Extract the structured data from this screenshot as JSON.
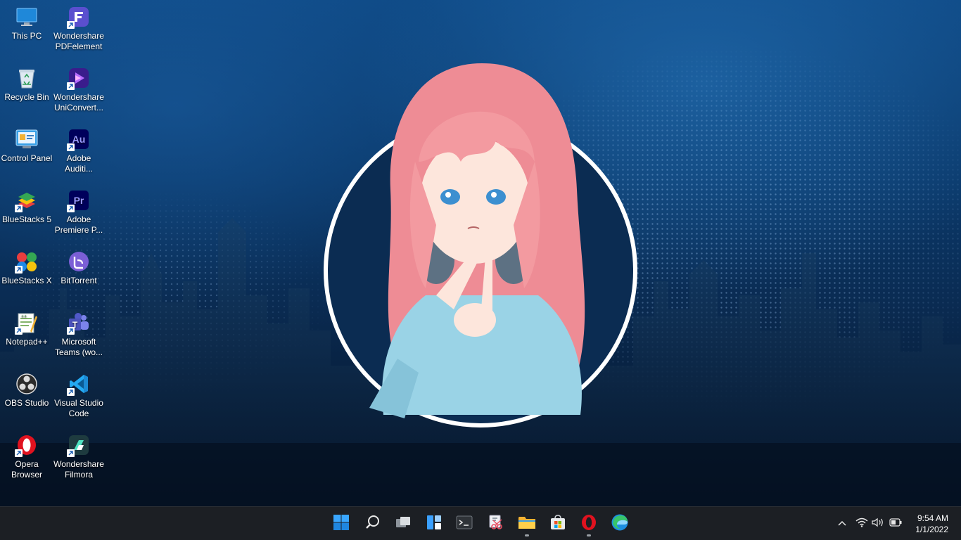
{
  "desktop": {
    "icons": [
      {
        "label": "This PC",
        "icon": "computer-icon"
      },
      {
        "label": "Wondershare PDFelement",
        "icon": "pdfelement-icon"
      },
      {
        "label": "Recycle Bin",
        "icon": "recycle-bin-icon"
      },
      {
        "label": "Wondershare UniConvert...",
        "icon": "uniconverter-icon"
      },
      {
        "label": "Control Panel",
        "icon": "control-panel-icon"
      },
      {
        "label": "Adobe Auditi...",
        "icon": "adobe-audition-icon"
      },
      {
        "label": "BlueStacks 5",
        "icon": "bluestacks-icon"
      },
      {
        "label": "Adobe Premiere P...",
        "icon": "adobe-premiere-icon"
      },
      {
        "label": "BlueStacks X",
        "icon": "bluestacks-x-icon"
      },
      {
        "label": "BitTorrent",
        "icon": "bittorrent-icon"
      },
      {
        "label": "Notepad++",
        "icon": "notepad-plus-plus-icon"
      },
      {
        "label": "Microsoft Teams (wo...",
        "icon": "teams-icon"
      },
      {
        "label": "OBS Studio",
        "icon": "obs-icon"
      },
      {
        "label": "Visual Studio Code",
        "icon": "vscode-icon"
      },
      {
        "label": "Opera Browser",
        "icon": "opera-icon"
      },
      {
        "label": "Wondershare Filmora",
        "icon": "filmora-icon"
      }
    ]
  },
  "taskbar": {
    "apps": [
      {
        "name": "start",
        "icon": "windows-start-icon",
        "running": false
      },
      {
        "name": "search",
        "icon": "search-icon",
        "running": false
      },
      {
        "name": "task-view",
        "icon": "task-view-icon",
        "running": false
      },
      {
        "name": "widgets",
        "icon": "widgets-icon",
        "running": false
      },
      {
        "name": "terminal",
        "icon": "terminal-icon",
        "running": false
      },
      {
        "name": "snipping-tool",
        "icon": "snipping-tool-icon",
        "running": false
      },
      {
        "name": "file-explorer",
        "icon": "folder-icon",
        "running": true
      },
      {
        "name": "microsoft-store",
        "icon": "store-icon",
        "running": false
      },
      {
        "name": "opera",
        "icon": "opera-icon",
        "running": true
      },
      {
        "name": "edge",
        "icon": "edge-icon",
        "running": false
      }
    ],
    "tray": {
      "icons": [
        "chevron-up-icon",
        "wifi-icon",
        "volume-icon",
        "battery-icon"
      ],
      "time": "9:54 AM",
      "date": "1/1/2022"
    }
  },
  "colors": {
    "taskbar_bg": "#1c1f24",
    "wallpaper_blue": "#0b3a6c",
    "hair_pink": "#f39aa0",
    "shirt_blue": "#9ad3e6"
  }
}
